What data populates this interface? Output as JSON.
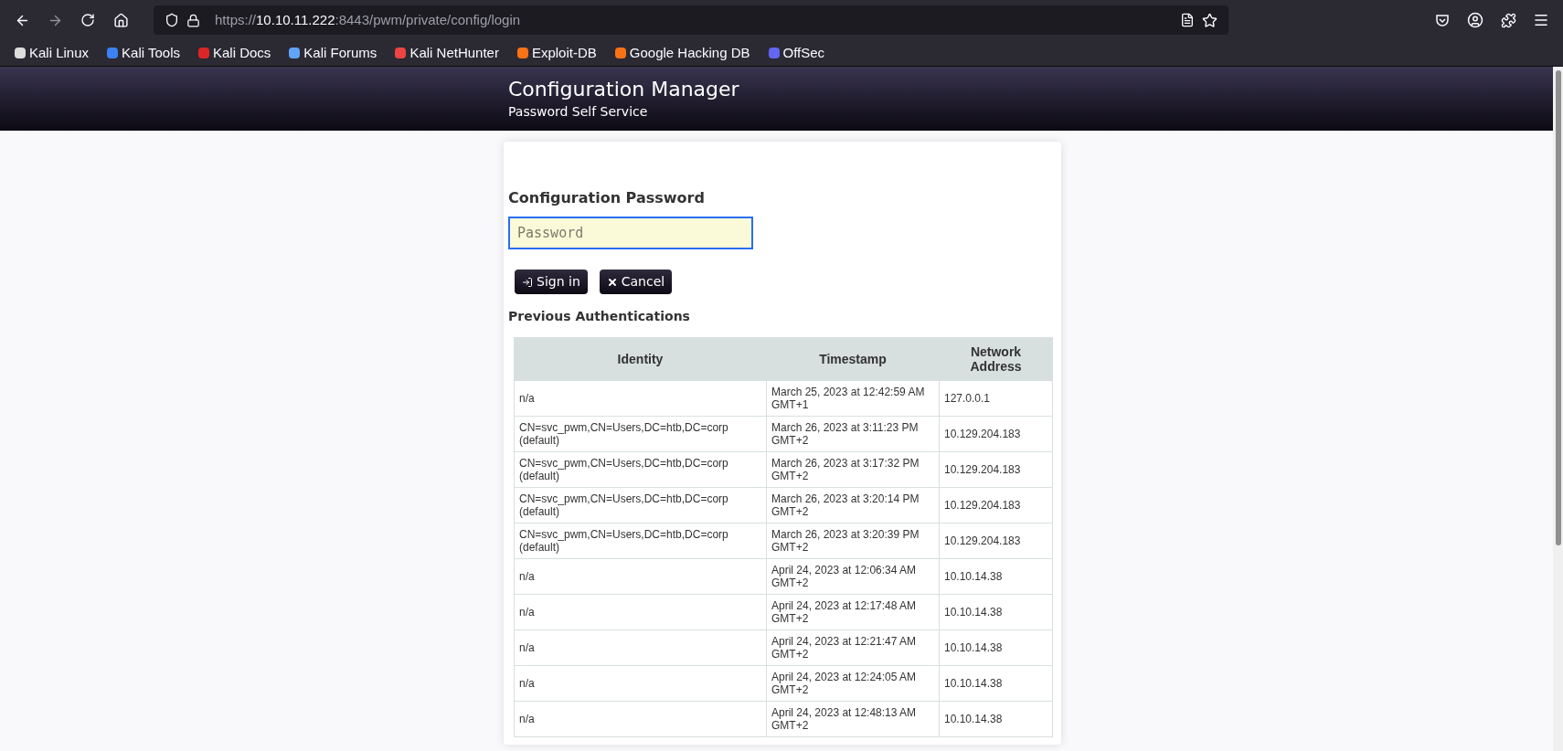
{
  "browser": {
    "url": {
      "scheme": "https://",
      "host": "10.10.11.222",
      "rest": ":8443/pwm/private/config/login"
    },
    "bookmarks": [
      {
        "label": "Kali Linux",
        "color": "#dddddd"
      },
      {
        "label": "Kali Tools",
        "color": "#3b82f6"
      },
      {
        "label": "Kali Docs",
        "color": "#dc2626"
      },
      {
        "label": "Kali Forums",
        "color": "#60a5fa"
      },
      {
        "label": "Kali NetHunter",
        "color": "#ef4444"
      },
      {
        "label": "Exploit-DB",
        "color": "#f97316"
      },
      {
        "label": "Google Hacking DB",
        "color": "#f97316"
      },
      {
        "label": "OffSec",
        "color": "#6366f1"
      }
    ]
  },
  "header": {
    "title": "Configuration Manager",
    "subtitle": "Password Self Service"
  },
  "form": {
    "heading": "Configuration Password",
    "password": {
      "placeholder": "Password"
    },
    "buttons": [
      {
        "kind": "signin",
        "label": "Sign in"
      },
      {
        "kind": "cancel",
        "label": "Cancel"
      }
    ]
  },
  "history": {
    "heading": "Previous Authentications",
    "columns": [
      "Identity",
      "Timestamp",
      "Network Address"
    ],
    "rows": [
      [
        "n/a",
        "March 25, 2023 at 12:42:59 AM GMT+1",
        "127.0.0.1"
      ],
      [
        "CN=svc_pwm,CN=Users,DC=htb,DC=corp (default)",
        "March 26, 2023 at 3:11:23 PM GMT+2",
        "10.129.204.183"
      ],
      [
        "CN=svc_pwm,CN=Users,DC=htb,DC=corp (default)",
        "March 26, 2023 at 3:17:32 PM GMT+2",
        "10.129.204.183"
      ],
      [
        "CN=svc_pwm,CN=Users,DC=htb,DC=corp (default)",
        "March 26, 2023 at 3:20:14 PM GMT+2",
        "10.129.204.183"
      ],
      [
        "CN=svc_pwm,CN=Users,DC=htb,DC=corp (default)",
        "March 26, 2023 at 3:20:39 PM GMT+2",
        "10.129.204.183"
      ],
      [
        "n/a",
        "April 24, 2023 at 12:06:34 AM GMT+2",
        "10.10.14.38"
      ],
      [
        "n/a",
        "April 24, 2023 at 12:17:48 AM GMT+2",
        "10.10.14.38"
      ],
      [
        "n/a",
        "April 24, 2023 at 12:21:47 AM GMT+2",
        "10.10.14.38"
      ],
      [
        "n/a",
        "April 24, 2023 at 12:24:05 AM GMT+2",
        "10.10.14.38"
      ],
      [
        "n/a",
        "April 24, 2023 at 12:48:13 AM GMT+2",
        "10.10.14.38"
      ]
    ]
  }
}
